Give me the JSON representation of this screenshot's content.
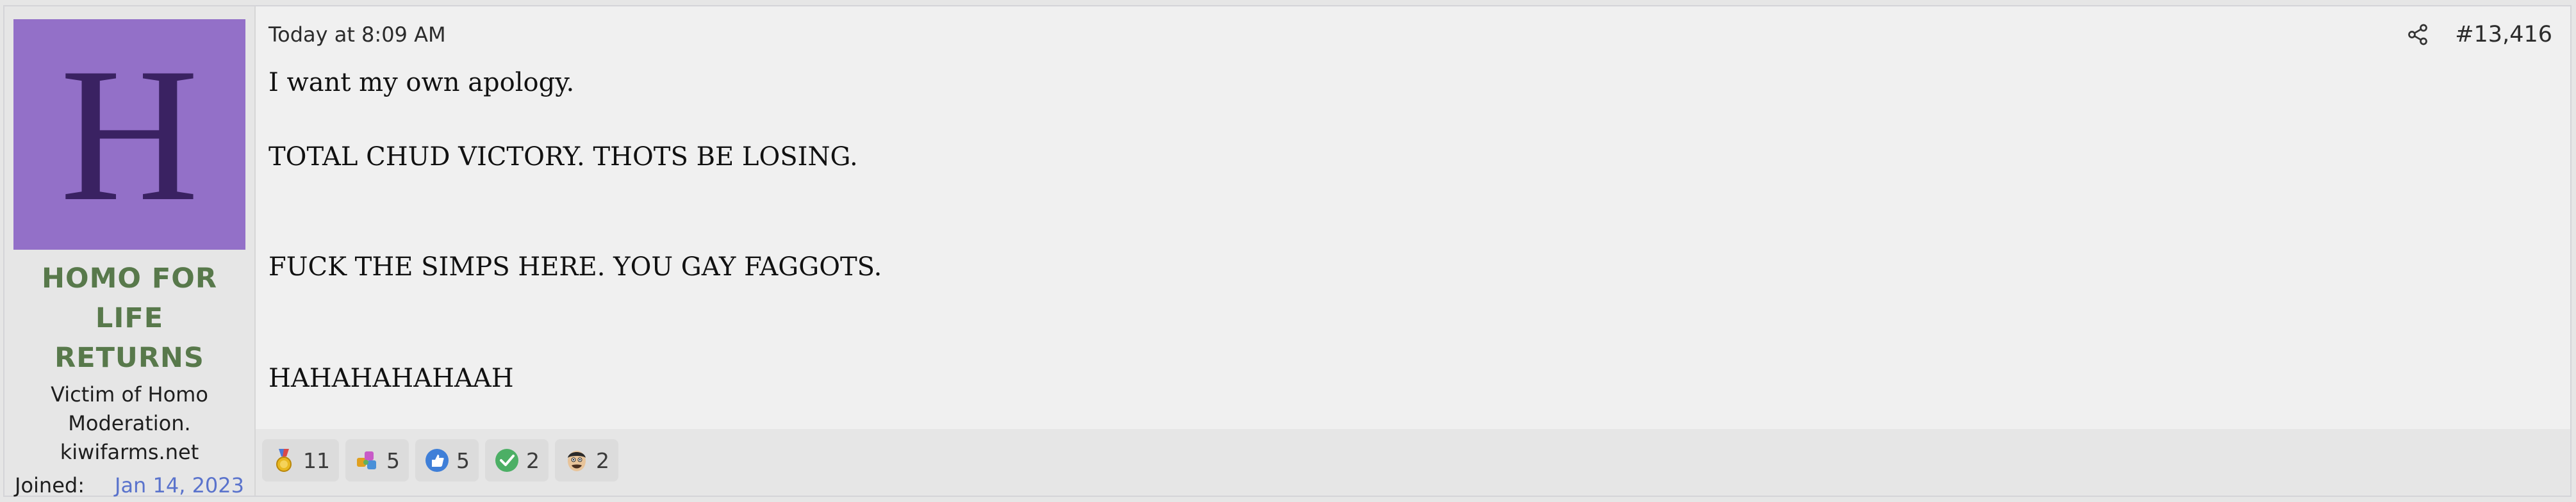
{
  "user": {
    "avatar_letter": "H",
    "name_line1": "HOMO FOR LIFE",
    "name_line2": "RETURNS",
    "title_line1": "Victim of Homo",
    "title_line2": "Moderation.",
    "title_line3": "kiwifarms.net",
    "joined_label": "Joined:",
    "joined_value": "Jan 14, 2023"
  },
  "post": {
    "date": "Today at 8:09 AM",
    "number": "#13,416",
    "lines": [
      "I want my own apology.",
      "TOTAL CHUD VICTORY. THOTS BE LOSING.",
      "FUCK THE SIMPS HERE. YOU GAY FAGGOTS.",
      "HAHAHAHAHAAH"
    ]
  },
  "reactions": [
    {
      "icon": "gold-medal-icon",
      "count": "11"
    },
    {
      "icon": "puzzle-pieces-icon",
      "count": "5"
    },
    {
      "icon": "thumbs-up-icon",
      "count": "5"
    },
    {
      "icon": "checkmark-icon",
      "count": "2"
    },
    {
      "icon": "face-icon",
      "count": "2"
    }
  ],
  "colors": {
    "avatar_bg": "#9370c8",
    "avatar_letter": "#3a2262",
    "username": "#58794b",
    "joined_date": "#5a73cc"
  }
}
